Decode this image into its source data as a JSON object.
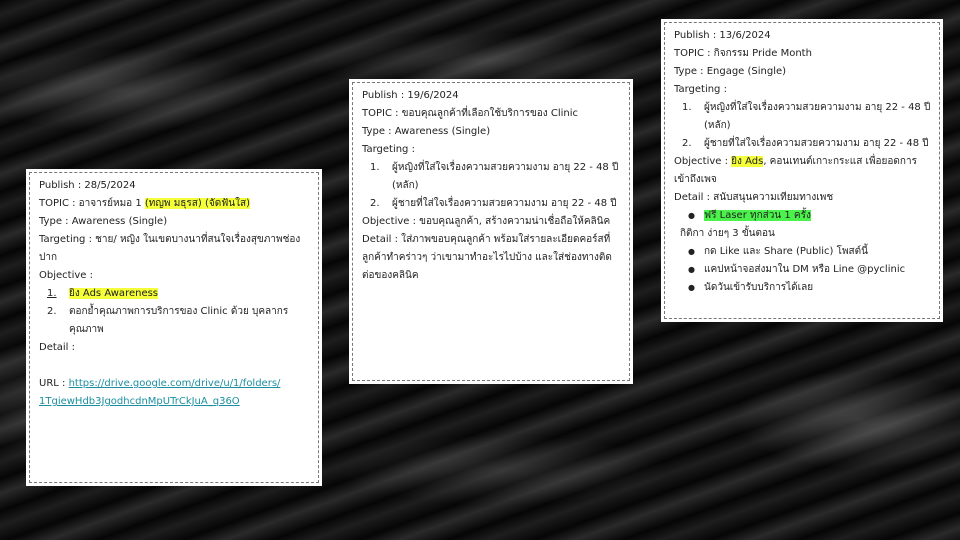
{
  "card1": {
    "publish": "Publish : 28/5/2024",
    "topic_prefix": "TOPIC : อาจารย์หมอ 1 ",
    "topic_highlight": "(ทญพ มธุรส) (จัดฟันใส)",
    "type": "Type : Awareness (Single)",
    "targeting": "Targeting : ชาย/ หญิง ในเขตบางนาที่สนใจเรื่องสุขภาพช่องปาก",
    "objective": "Objective :",
    "obj_items": [
      {
        "num": "1.",
        "text": "ยิง Ads Awareness"
      },
      {
        "num": "2.",
        "text": "ตอกย้ำคุณภาพการบริการของ Clinic ด้วย บุคลากรคุณภาพ"
      }
    ],
    "detail": "Detail :",
    "url_label": "URL : ",
    "url_line1": "https://drive.google.com/drive/u/1/folders/",
    "url_line2": "1TgiewHdb3JgodhcdnMpUTrCkJuA_q36O"
  },
  "card2": {
    "publish": "Publish : 19/6/2024",
    "topic": "TOPIC : ขอบคุณลูกค้าที่เลือกใช้บริการของ Clinic",
    "type": "Type : Awareness (Single)",
    "targeting": "Targeting :",
    "target_items": [
      {
        "num": "1.",
        "text": "ผู้หญิงที่ใส่ใจเรื่องความสวยความงาม อายุ 22 - 48 ปี (หลัก)"
      },
      {
        "num": "2.",
        "text": "ผู้ชายที่ใส่ใจเรื่องความสวยความงาม อายุ 22 - 48 ปี"
      }
    ],
    "objective": "Objective : ขอบคุณลูกค้า, สร้างความน่าเชื่อถือให้คลินิค",
    "detail": "Detail : ใส่ภาพขอบคุณลูกค้า พร้อมใส่รายละเอียดคอร์สที่ลูกค้าทำคร่าวๆ ว่าเขามาทำอะไรไปบ้าง และใส่ช่องทางติดต่อของคลินิค"
  },
  "card3": {
    "publish": "Publish : 13/6/2024",
    "topic": "TOPIC : กิจกรรม Pride Month",
    "type": "Type : Engage (Single)",
    "targeting": "Targeting :",
    "target_items": [
      {
        "num": "1.",
        "text": "ผู้หญิงที่ใส่ใจเรื่องความสวยความงาม อายุ 22 - 48 ปี (หลัก)"
      },
      {
        "num": "2.",
        "text": "ผู้ชายที่ใส่ใจเรื่องความสวยความงาม อายุ 22 - 48 ปี"
      }
    ],
    "objective_prefix": "Objective : ",
    "objective_highlight": "ยิง Ads",
    "objective_suffix": ", คอนเทนต์เกาะกระแส เพื่อยอดการเข้าถึงเพจ",
    "detail": "Detail :  สนับสนุนความเทียมทางเพช",
    "detail_highlight_item": "ฟรี Laser ทุกส่วน 1 ครั้ง",
    "rules_intro": "กิติกา ง่ายๆ 3 ขั้นตอน",
    "steps": [
      "กด Like และ Share (Public) โพสต์นี้",
      "แคปหน้าจอส่งมาใน DM หรือ Line @pyclinic",
      "นัดวันเข้ารับบริการได้เลย"
    ]
  },
  "colors": {
    "yellow_highlight": "#f4ff3a",
    "green_highlight": "#4cf24c",
    "link": "#1b8fa0"
  }
}
